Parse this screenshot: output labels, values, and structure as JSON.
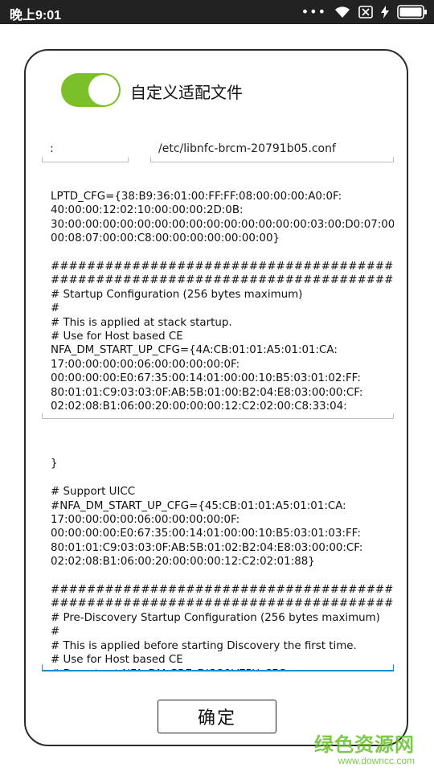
{
  "status_bar": {
    "time": "晚上9:01",
    "more_dots": "•••",
    "bolt": "⚡"
  },
  "dialog": {
    "switch_label": "自定义适配文件",
    "left_field": ":",
    "right_field": "/etc/libnfc-brcm-20791b05.conf",
    "text_block_1": [
      "LPTD_CFG={38:B9:36:01:00:FF:FF:08:00:00:00:A0:0F:",
      "40:00:00:12:02:10:00:00:00:2D:0B:",
      "30:00:00:00:00:00:00:00:00:00:00:00:00:00:00:03:00:D0:07:00:",
      "00:08:07:00:00:C8:00:00:00:00:00:00:00}",
      "",
      "##############################################",
      "#########################################",
      "# Startup Configuration (256 bytes maximum)",
      "#",
      "# This is applied at stack startup.",
      "# Use for Host based CE",
      "NFA_DM_START_UP_CFG={4A:CB:01:01:A5:01:01:CA:",
      "17:00:00:00:00:06:00:00:00:00:0F:",
      "00:00:00:00:E0:67:35:00:14:01:00:00:10:B5:03:01:02:FF:",
      "80:01:01:C9:03:03:0F:AB:5B:01:00:B2:04:E8:03:00:00:CF:",
      "02:02:08:B1:06:00:20:00:00:00:12:C2:02:00:C8:33:04:"
    ],
    "text_block_2": [
      "",
      "}",
      "",
      "# Support UICC",
      "#NFA_DM_START_UP_CFG={45:CB:01:01:A5:01:01:CA:",
      "17:00:00:00:00:06:00:00:00:00:0F:",
      "00:00:00:00:E0:67:35:00:14:01:00:00:10:B5:03:01:03:FF:",
      "80:01:01:C9:03:03:0F:AB:5B:01:02:B2:04:E8:03:00:00:CF:",
      "02:02:08:B1:06:00:20:00:00:00:12:C2:02:01:88}",
      "",
      "##############################################",
      "#########################################",
      "# Pre-Discovery Startup Configuration (256 bytes maximum)",
      "#",
      "# This is applied before starting Discovery the first time.",
      "# Use for Host based CE",
      "# Do not set NFA_DM_PRE_DISCOVERY_CFG"
    ],
    "confirm_label": "确定"
  },
  "watermark": {
    "main": "绿色资源网",
    "sub": "www.downcc.com"
  },
  "colors": {
    "toggle_on": "#7bbf2a",
    "focus_underline": "#1a8fc7",
    "status_bar_bg": "#222222",
    "watermark": "#6bbf2e"
  },
  "icons": {
    "wifi": "wifi-icon",
    "no_sim": "sim-x-icon",
    "charging": "bolt-icon",
    "battery": "battery-icon"
  }
}
